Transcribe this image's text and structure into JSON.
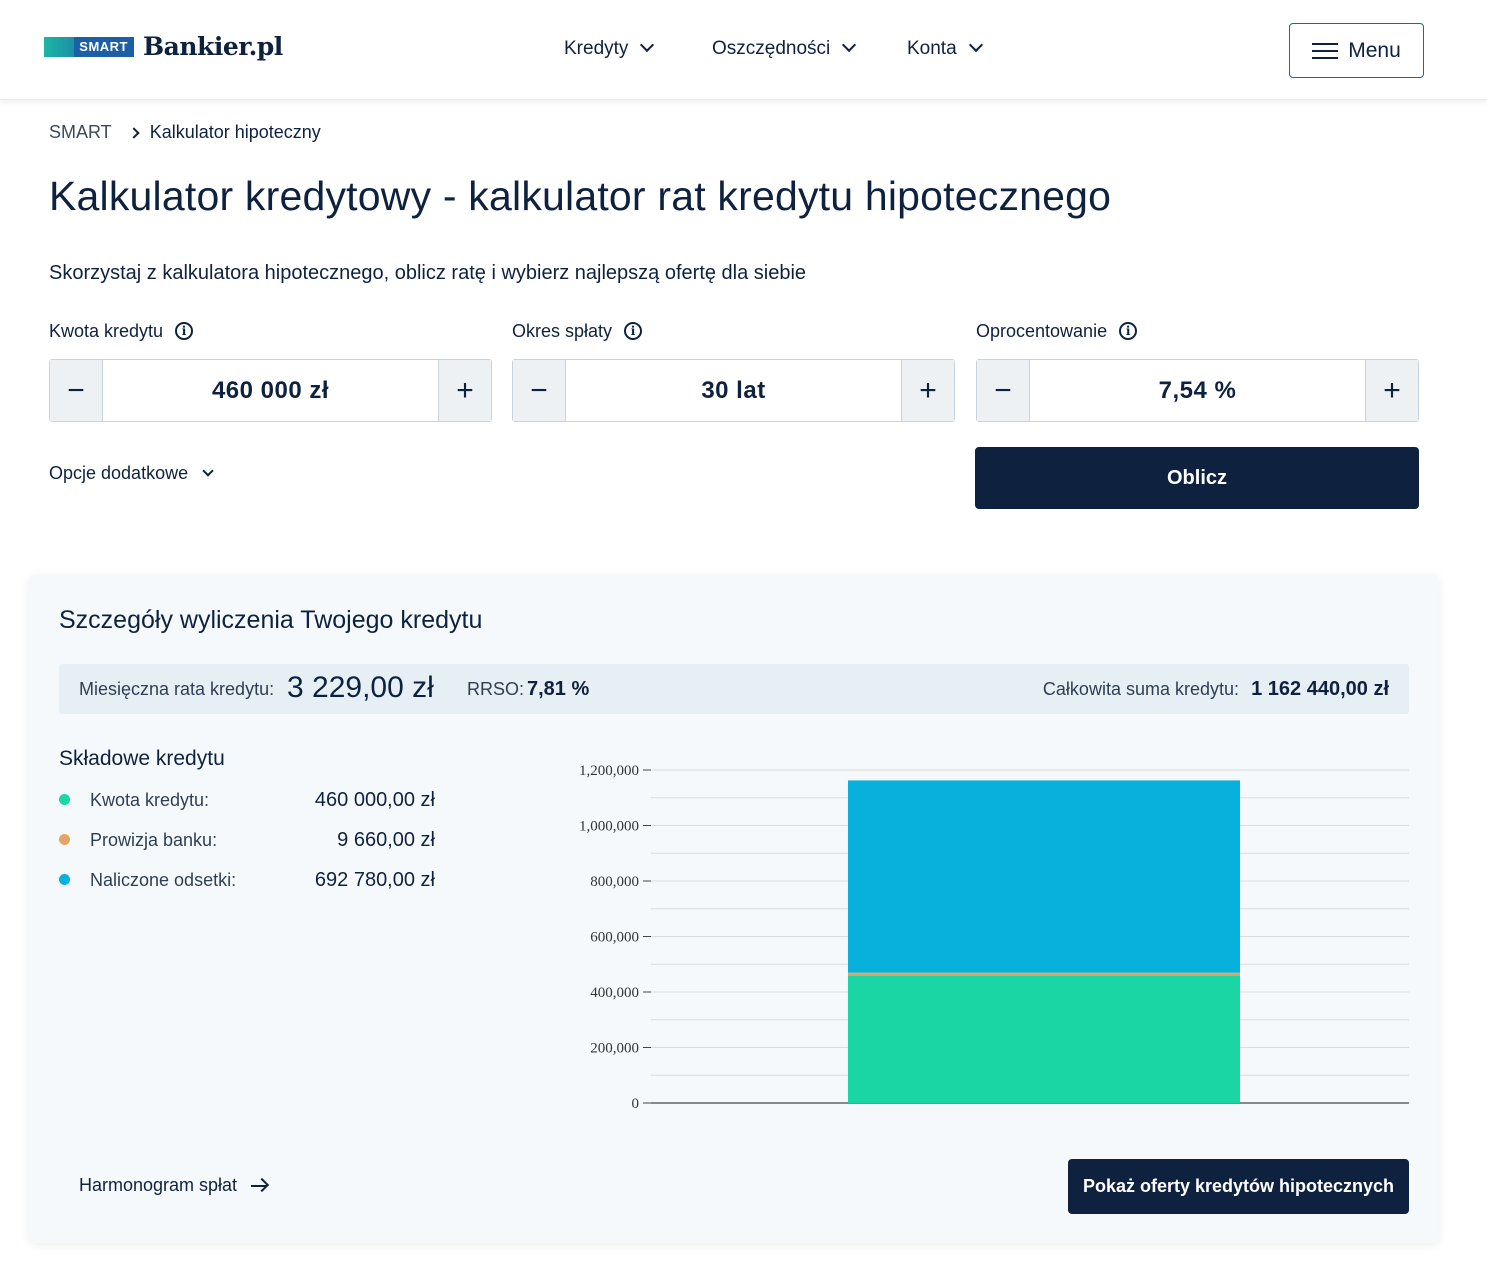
{
  "header": {
    "logo_badge": "SMART",
    "logo_text": "Bankier.pl",
    "nav": [
      {
        "label": "Kredyty"
      },
      {
        "label": "Oszczędności"
      },
      {
        "label": "Konta"
      }
    ],
    "menu_label": "Menu"
  },
  "breadcrumb": {
    "root": "SMART",
    "current": "Kalkulator hipoteczny"
  },
  "page": {
    "title": "Kalkulator kredytowy - kalkulator rat kredytu hipotecznego",
    "subtitle": "Skorzystaj z kalkulatora hipotecznego, oblicz ratę i wybierz najlepszą ofertę dla siebie"
  },
  "inputs": [
    {
      "label": "Kwota kredytu",
      "value": "460 000 zł"
    },
    {
      "label": "Okres spłaty",
      "value": "30 lat"
    },
    {
      "label": "Oprocentowanie",
      "value": "7,54 %"
    }
  ],
  "options_label": "Opcje dodatkowe",
  "calculate_label": "Oblicz",
  "results": {
    "title": "Szczegóły wyliczenia Twojego kredytu",
    "monthly_label": "Miesięczna rata kredytu:",
    "monthly_value": "3 229,00 zł",
    "rrso_label": "RRSO:",
    "rrso_value": "7,81 %",
    "total_label": "Całkowita suma kredytu:",
    "total_value": "1 162 440,00 zł",
    "components_title": "Składowe kredytu",
    "components": [
      {
        "label": "Kwota kredytu:",
        "value": "460 000,00 zł",
        "color": "#19d6a4"
      },
      {
        "label": "Prowizja banku:",
        "value": "9 660,00 zł",
        "color": "#e3a765"
      },
      {
        "label": "Naliczone odsetki:",
        "value": "692 780,00 zł",
        "color": "#08b1dc"
      }
    ],
    "schedule_label": "Harmonogram spłat",
    "offers_label": "Pokaż oferty kredytów hipotecznych"
  },
  "chart_data": {
    "type": "bar",
    "stacked": true,
    "categories": [
      ""
    ],
    "series": [
      {
        "values": [
          460000
        ],
        "color": "#19d6a4"
      },
      {
        "values": [
          9660
        ],
        "color": "#e3a765"
      },
      {
        "values": [
          692780
        ],
        "color": "#08b1dc"
      }
    ],
    "ylim": [
      0,
      1200000
    ],
    "yticks": [
      0,
      200000,
      400000,
      600000,
      800000,
      1000000,
      1200000
    ],
    "ytick_labels": [
      "0",
      "200,000",
      "400,000",
      "600,000",
      "800,000",
      "1,000,000",
      "1,200,000"
    ],
    "grid": true
  }
}
